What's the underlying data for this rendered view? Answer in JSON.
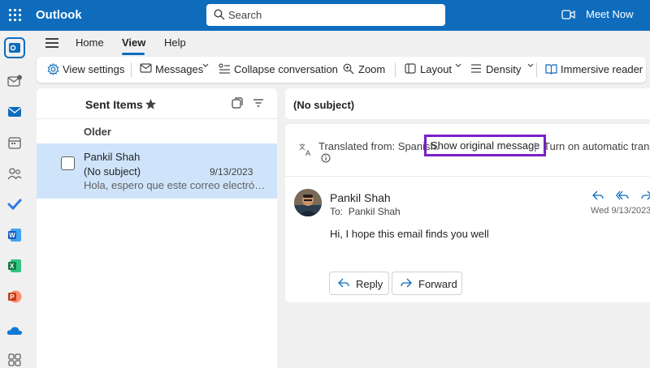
{
  "topbar": {
    "app_name": "Outlook",
    "search_placeholder": "Search",
    "meet_now": "Meet Now"
  },
  "ribbon": {
    "tabs": [
      {
        "label": "Home"
      },
      {
        "label": "View",
        "active": true
      },
      {
        "label": "Help"
      }
    ],
    "toolbar": {
      "view_settings": "View settings",
      "messages": "Messages",
      "collapse_conversation": "Collapse conversation",
      "zoom": "Zoom",
      "layout": "Layout",
      "density": "Density",
      "immersive_reader": "Immersive reader"
    }
  },
  "folder": {
    "name": "Sent Items",
    "group_label": "Older"
  },
  "messages": [
    {
      "sender": "Pankil Shah",
      "subject": "(No subject)",
      "date": "9/13/2023",
      "preview": "Hola, espero que este correo electró…"
    }
  ],
  "reading": {
    "subject": "(No subject)",
    "translated_from": "Translated from: Spanish.",
    "show_original": "Show original message",
    "separator": "|",
    "turn_on_auto": "Turn on automatic transla",
    "sender": "Pankil Shah",
    "to_label": "To:",
    "to_name": "Pankil Shah",
    "date": "Wed 9/13/2023",
    "body": "Hi, I hope this email finds you well",
    "reply": "Reply",
    "forward": "Forward"
  },
  "colors": {
    "brand": "#0f6cbd",
    "highlight": "#7b1fc9",
    "selected_row": "#cfe4fa"
  }
}
